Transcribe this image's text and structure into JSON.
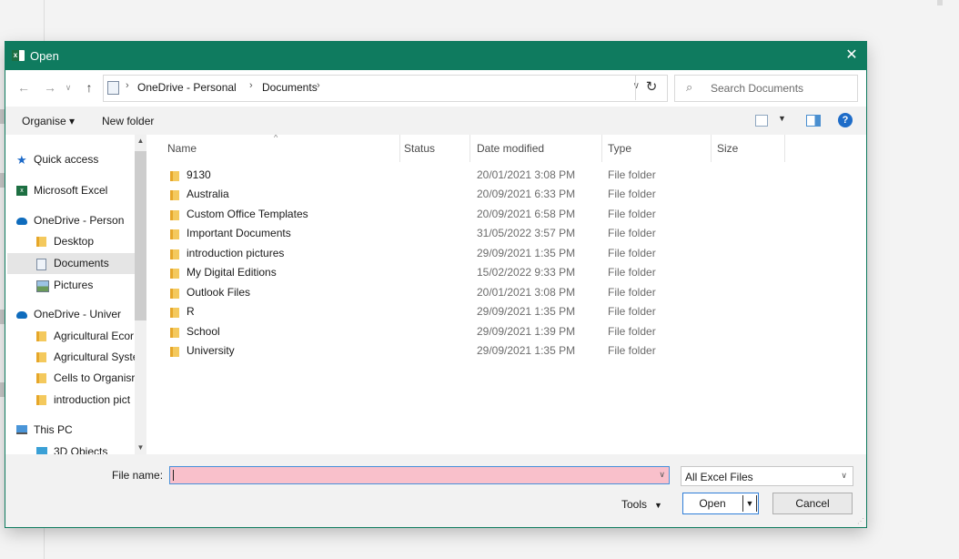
{
  "window": {
    "title": "Open",
    "app_icon": "excel-icon",
    "accent": "#0f7b5f"
  },
  "navigation": {
    "back_icon": "arrow-left-icon",
    "forward_icon": "arrow-right-icon",
    "recent_icon": "chevron-down-icon",
    "up_icon": "arrow-up-icon",
    "breadcrumb": [
      "OneDrive - Personal",
      "Documents"
    ],
    "refresh_icon": "refresh-icon",
    "search_placeholder": "Search Documents"
  },
  "toolbar": {
    "organise": "Organise ▾",
    "new_folder": "New folder",
    "help": "?"
  },
  "sidebar": {
    "items": [
      {
        "label": "Quick access",
        "icon": "star-icon"
      },
      {
        "label": "Microsoft Excel",
        "icon": "excel-icon"
      },
      {
        "label": "OneDrive - Person",
        "icon": "cloud-icon"
      },
      {
        "label": "Desktop",
        "icon": "folder-icon"
      },
      {
        "label": "Documents",
        "icon": "document-icon",
        "selected": true
      },
      {
        "label": "Pictures",
        "icon": "picture-icon"
      },
      {
        "label": "OneDrive - Univer",
        "icon": "cloud-icon"
      },
      {
        "label": "Agricultural Ecor",
        "icon": "folder-icon"
      },
      {
        "label": "Agricultural Syste",
        "icon": "folder-icon"
      },
      {
        "label": "Cells to Organisr",
        "icon": "folder-icon"
      },
      {
        "label": "introduction pict",
        "icon": "folder-icon"
      },
      {
        "label": "This PC",
        "icon": "computer-icon"
      },
      {
        "label": "3D Objects",
        "icon": "cube-icon"
      }
    ]
  },
  "filelist": {
    "columns": [
      "Name",
      "Status",
      "Date modified",
      "Type",
      "Size"
    ],
    "rows": [
      {
        "name": "9130",
        "date": "20/01/2021 3:08 PM",
        "type": "File folder"
      },
      {
        "name": "Australia",
        "date": "20/09/2021 6:33 PM",
        "type": "File folder"
      },
      {
        "name": "Custom Office Templates",
        "date": "20/09/2021 6:58 PM",
        "type": "File folder"
      },
      {
        "name": "Important Documents",
        "date": "31/05/2022 3:57 PM",
        "type": "File folder"
      },
      {
        "name": "introduction pictures",
        "date": "29/09/2021 1:35 PM",
        "type": "File folder"
      },
      {
        "name": "My Digital Editions",
        "date": "15/02/2022 9:33 PM",
        "type": "File folder"
      },
      {
        "name": "Outlook Files",
        "date": "20/01/2021 3:08 PM",
        "type": "File folder"
      },
      {
        "name": "R",
        "date": "29/09/2021 1:35 PM",
        "type": "File folder"
      },
      {
        "name": "School",
        "date": "29/09/2021 1:39 PM",
        "type": "File folder"
      },
      {
        "name": "University",
        "date": "29/09/2021 1:35 PM",
        "type": "File folder"
      }
    ]
  },
  "footer": {
    "file_name_label": "File name:",
    "file_name_value": "",
    "file_type": "All Excel Files",
    "tools": "Tools",
    "open": "Open",
    "cancel": "Cancel"
  }
}
